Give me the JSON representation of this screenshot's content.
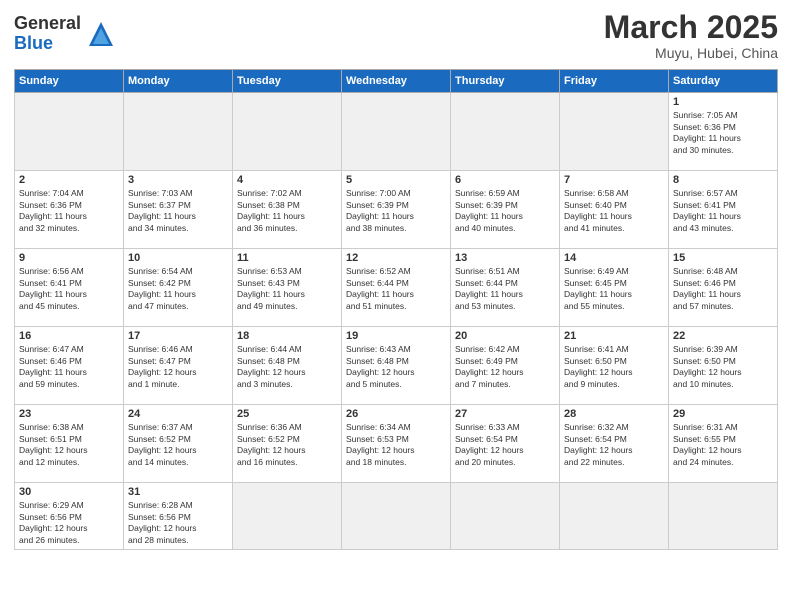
{
  "header": {
    "logo_general": "General",
    "logo_blue": "Blue",
    "month_title": "March 2025",
    "subtitle": "Muyu, Hubei, China"
  },
  "weekdays": [
    "Sunday",
    "Monday",
    "Tuesday",
    "Wednesday",
    "Thursday",
    "Friday",
    "Saturday"
  ],
  "weeks": [
    [
      {
        "day": "",
        "empty": true
      },
      {
        "day": "",
        "empty": true
      },
      {
        "day": "",
        "empty": true
      },
      {
        "day": "",
        "empty": true
      },
      {
        "day": "",
        "empty": true
      },
      {
        "day": "",
        "empty": true
      },
      {
        "day": "1",
        "info": "Sunrise: 7:05 AM\nSunset: 6:36 PM\nDaylight: 11 hours\nand 30 minutes."
      }
    ],
    [
      {
        "day": "2",
        "info": "Sunrise: 7:04 AM\nSunset: 6:36 PM\nDaylight: 11 hours\nand 32 minutes."
      },
      {
        "day": "3",
        "info": "Sunrise: 7:03 AM\nSunset: 6:37 PM\nDaylight: 11 hours\nand 34 minutes."
      },
      {
        "day": "4",
        "info": "Sunrise: 7:02 AM\nSunset: 6:38 PM\nDaylight: 11 hours\nand 36 minutes."
      },
      {
        "day": "5",
        "info": "Sunrise: 7:00 AM\nSunset: 6:39 PM\nDaylight: 11 hours\nand 38 minutes."
      },
      {
        "day": "6",
        "info": "Sunrise: 6:59 AM\nSunset: 6:39 PM\nDaylight: 11 hours\nand 40 minutes."
      },
      {
        "day": "7",
        "info": "Sunrise: 6:58 AM\nSunset: 6:40 PM\nDaylight: 11 hours\nand 41 minutes."
      },
      {
        "day": "8",
        "info": "Sunrise: 6:57 AM\nSunset: 6:41 PM\nDaylight: 11 hours\nand 43 minutes."
      }
    ],
    [
      {
        "day": "9",
        "info": "Sunrise: 6:56 AM\nSunset: 6:41 PM\nDaylight: 11 hours\nand 45 minutes."
      },
      {
        "day": "10",
        "info": "Sunrise: 6:54 AM\nSunset: 6:42 PM\nDaylight: 11 hours\nand 47 minutes."
      },
      {
        "day": "11",
        "info": "Sunrise: 6:53 AM\nSunset: 6:43 PM\nDaylight: 11 hours\nand 49 minutes."
      },
      {
        "day": "12",
        "info": "Sunrise: 6:52 AM\nSunset: 6:44 PM\nDaylight: 11 hours\nand 51 minutes."
      },
      {
        "day": "13",
        "info": "Sunrise: 6:51 AM\nSunset: 6:44 PM\nDaylight: 11 hours\nand 53 minutes."
      },
      {
        "day": "14",
        "info": "Sunrise: 6:49 AM\nSunset: 6:45 PM\nDaylight: 11 hours\nand 55 minutes."
      },
      {
        "day": "15",
        "info": "Sunrise: 6:48 AM\nSunset: 6:46 PM\nDaylight: 11 hours\nand 57 minutes."
      }
    ],
    [
      {
        "day": "16",
        "info": "Sunrise: 6:47 AM\nSunset: 6:46 PM\nDaylight: 11 hours\nand 59 minutes."
      },
      {
        "day": "17",
        "info": "Sunrise: 6:46 AM\nSunset: 6:47 PM\nDaylight: 12 hours\nand 1 minute."
      },
      {
        "day": "18",
        "info": "Sunrise: 6:44 AM\nSunset: 6:48 PM\nDaylight: 12 hours\nand 3 minutes."
      },
      {
        "day": "19",
        "info": "Sunrise: 6:43 AM\nSunset: 6:48 PM\nDaylight: 12 hours\nand 5 minutes."
      },
      {
        "day": "20",
        "info": "Sunrise: 6:42 AM\nSunset: 6:49 PM\nDaylight: 12 hours\nand 7 minutes."
      },
      {
        "day": "21",
        "info": "Sunrise: 6:41 AM\nSunset: 6:50 PM\nDaylight: 12 hours\nand 9 minutes."
      },
      {
        "day": "22",
        "info": "Sunrise: 6:39 AM\nSunset: 6:50 PM\nDaylight: 12 hours\nand 10 minutes."
      }
    ],
    [
      {
        "day": "23",
        "info": "Sunrise: 6:38 AM\nSunset: 6:51 PM\nDaylight: 12 hours\nand 12 minutes."
      },
      {
        "day": "24",
        "info": "Sunrise: 6:37 AM\nSunset: 6:52 PM\nDaylight: 12 hours\nand 14 minutes."
      },
      {
        "day": "25",
        "info": "Sunrise: 6:36 AM\nSunset: 6:52 PM\nDaylight: 12 hours\nand 16 minutes."
      },
      {
        "day": "26",
        "info": "Sunrise: 6:34 AM\nSunset: 6:53 PM\nDaylight: 12 hours\nand 18 minutes."
      },
      {
        "day": "27",
        "info": "Sunrise: 6:33 AM\nSunset: 6:54 PM\nDaylight: 12 hours\nand 20 minutes."
      },
      {
        "day": "28",
        "info": "Sunrise: 6:32 AM\nSunset: 6:54 PM\nDaylight: 12 hours\nand 22 minutes."
      },
      {
        "day": "29",
        "info": "Sunrise: 6:31 AM\nSunset: 6:55 PM\nDaylight: 12 hours\nand 24 minutes."
      }
    ],
    [
      {
        "day": "30",
        "info": "Sunrise: 6:29 AM\nSunset: 6:56 PM\nDaylight: 12 hours\nand 26 minutes."
      },
      {
        "day": "31",
        "info": "Sunrise: 6:28 AM\nSunset: 6:56 PM\nDaylight: 12 hours\nand 28 minutes."
      },
      {
        "day": "",
        "empty": true
      },
      {
        "day": "",
        "empty": true
      },
      {
        "day": "",
        "empty": true
      },
      {
        "day": "",
        "empty": true
      },
      {
        "day": "",
        "empty": true
      }
    ]
  ]
}
